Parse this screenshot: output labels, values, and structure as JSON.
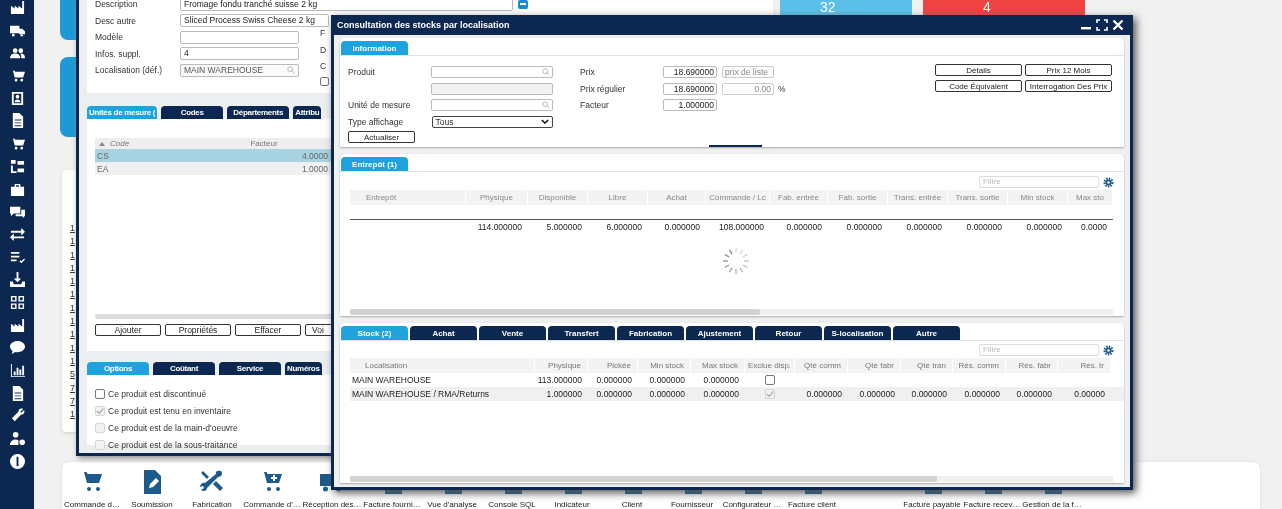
{
  "tiles": [
    {
      "value": "32",
      "color": "#5bc0e8"
    },
    {
      "value": "4",
      "color": "#ef4444"
    }
  ],
  "background_list": [
    "1",
    "1",
    "1",
    "1",
    "1",
    "1",
    "1",
    "1",
    "1",
    "1",
    "1",
    "5",
    "7",
    "7",
    "1"
  ],
  "product_window": {
    "fields": [
      {
        "label": "Description",
        "value": "Fromage fondu tranché suisse 2 kg",
        "kind": "long"
      },
      {
        "label": "Desc autre",
        "value": "Sliced Process Swiss Cheese 2 kg",
        "kind": "text"
      },
      {
        "label": "Modèle",
        "kind": "short"
      },
      {
        "label": "Infos. suppl.",
        "value": "4",
        "kind": "short"
      },
      {
        "label": "Localisation (déf.)",
        "value": "MAIN WAREHOUSE",
        "kind": "lookup"
      }
    ],
    "side_labels": [
      "F",
      "D",
      "C"
    ],
    "side_checkbox": {
      "checked": false
    },
    "tabs": [
      {
        "label": "Unités de mesure (",
        "selected": true
      },
      {
        "label": "Codes",
        "selected": false
      },
      {
        "label": "Départements",
        "selected": false
      },
      {
        "label": "Attribu",
        "selected": false
      }
    ],
    "grid": {
      "columns": [
        {
          "label": "Code",
          "sorted": true
        },
        {
          "label": "Facteur",
          "sorted": false
        }
      ],
      "rows": [
        {
          "code": "CS",
          "factor": "4.0000",
          "selected": true
        },
        {
          "code": "EA",
          "factor": "1.0000",
          "selected": false
        }
      ]
    },
    "buttons": [
      "Ajouter",
      "Propriétés",
      "Effacer",
      "Voi"
    ],
    "option_tabs": [
      {
        "label": "Options",
        "selected": true
      },
      {
        "label": "Coûtant",
        "selected": false
      },
      {
        "label": "Service",
        "selected": false
      },
      {
        "label": "Numéros",
        "selected": false
      }
    ],
    "options": [
      {
        "label": "Ce produit est discontinué",
        "checked": false,
        "disabled": false
      },
      {
        "label": "Ce produit est tenu en inventaire",
        "checked": true,
        "disabled": true
      },
      {
        "label": "Ce produit est de la main-d'oeuvre",
        "checked": false,
        "disabled": true
      },
      {
        "label": "Ce produit est de la sous-traitance",
        "checked": false,
        "disabled": true
      }
    ]
  },
  "dialog": {
    "title": "Consultation des stocks par localisation",
    "info": {
      "tab": {
        "label": "Information",
        "selected": true
      },
      "fields": [
        {
          "label": "Produit",
          "kind": "lookup"
        },
        {
          "kind": "readonly"
        },
        {
          "label": "Unité de mesure",
          "kind": "lookup"
        },
        {
          "label": "Type affichage",
          "kind": "select",
          "value": "Tous"
        }
      ],
      "refresh_button": "Actualiser",
      "prices": [
        {
          "label": "Prix",
          "value": "18.690000",
          "extra": {
            "text": "prix de liste",
            "kind": "label"
          }
        },
        {
          "label": "Prix régulier",
          "value": "18.690000",
          "extra": {
            "text": "0.00",
            "kind": "number"
          },
          "unit": "%"
        },
        {
          "label": "Facteur",
          "value": "1.000000"
        }
      ],
      "buttons": [
        "Détails",
        "Prix 12 Mois",
        "Code Équivalent",
        "Interrogation Des Prix"
      ]
    },
    "warehouse": {
      "tab": {
        "label": "Entrepôt (1)",
        "selected": true
      },
      "filter_placeholder": "Filtre",
      "columns": [
        "Entrepôt",
        "Physique",
        "Disponible",
        "Libre",
        "Achat",
        "Commande / Lc",
        "Fab. entrée",
        "Fab. sortie",
        "Trans. entrée",
        "Trans. sortie",
        "Min stock",
        "Max sto"
      ],
      "totals": [
        "114.000000",
        "5.000000",
        "6.000000",
        "0.000000",
        "108.000000",
        "0.000000",
        "0.000000",
        "0.000000",
        "0.000000",
        "0.000000",
        "0.0000"
      ]
    },
    "stock": {
      "tabs": [
        {
          "label": "Stock (2)",
          "selected": true
        },
        {
          "label": "Achat",
          "selected": false
        },
        {
          "label": "Vente",
          "selected": false
        },
        {
          "label": "Transfert",
          "selected": false
        },
        {
          "label": "Fabrication",
          "selected": false
        },
        {
          "label": "Ajustement",
          "selected": false
        },
        {
          "label": "Retour",
          "selected": false
        },
        {
          "label": "S-localisation",
          "selected": false
        },
        {
          "label": "Autre",
          "selected": false
        }
      ],
      "filter_placeholder": "Filtre",
      "columns": [
        "Localisation",
        "Physique",
        "Pickée",
        "Min stock",
        "Max stock",
        "Exclue disp.",
        "Qté comm",
        "Qté fabr",
        "Qté tran",
        "Rés. comm",
        "Rés. fabr",
        "Rés. tr"
      ],
      "rows": [
        {
          "location": "MAIN WAREHOUSE",
          "values": [
            "113.000000",
            "0.000000",
            "0.000000",
            "0.000000"
          ],
          "excluded": false,
          "excluded_disabled": false
        },
        {
          "location": "MAIN WAREHOUSE / RMA/Returns",
          "values": [
            "1.000000",
            "0.000000",
            "0.000000",
            "0.000000"
          ],
          "excluded": true,
          "excluded_disabled": true,
          "more": [
            "0.000000",
            "0.000000",
            "0.000000",
            "0.000000",
            "0.000000",
            "0.00000"
          ]
        }
      ]
    }
  },
  "toolbar": [
    {
      "label": "Commande d…",
      "kind": "item"
    },
    {
      "label": "Soumission",
      "kind": "item"
    },
    {
      "label": "Fabrication",
      "kind": "item"
    },
    {
      "label": "Commande d'…",
      "kind": "item"
    },
    {
      "label": "Réception des…",
      "kind": "item"
    },
    {
      "label": "Facture fourni…",
      "kind": "item"
    },
    {
      "label": "Vue d'analyse",
      "kind": "item"
    },
    {
      "label": "Console SQL",
      "kind": "item"
    },
    {
      "label": "Indicateur",
      "kind": "item"
    },
    {
      "label": "Client",
      "kind": "item"
    },
    {
      "label": "Fournisseur",
      "kind": "item"
    },
    {
      "label": "Configurateur …",
      "kind": "item"
    },
    {
      "label": "Facture client",
      "kind": "item"
    },
    {
      "kind": "spacer"
    },
    {
      "label": "Facture payable",
      "kind": "item"
    },
    {
      "label": "Facture recev…",
      "kind": "item"
    },
    {
      "label": "Gestion de la f…",
      "kind": "item"
    }
  ]
}
